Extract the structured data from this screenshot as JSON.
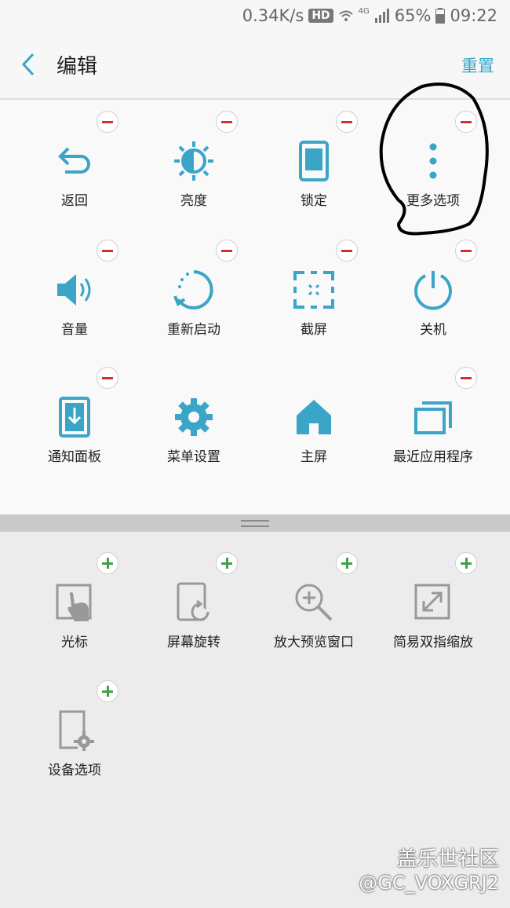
{
  "status_bar": {
    "speed": "0.34K/s",
    "hd": "HD",
    "network": "4G",
    "battery": "65%",
    "time": "09:22"
  },
  "header": {
    "title": "编辑",
    "reset_label": "重置"
  },
  "active_items": [
    {
      "label": "返回",
      "icon": "back-arrow-icon"
    },
    {
      "label": "亮度",
      "icon": "brightness-icon"
    },
    {
      "label": "锁定",
      "icon": "lock-screen-icon"
    },
    {
      "label": "更多选项",
      "icon": "more-options-icon"
    },
    {
      "label": "音量",
      "icon": "volume-icon"
    },
    {
      "label": "重新启动",
      "icon": "restart-icon"
    },
    {
      "label": "截屏",
      "icon": "screenshot-icon"
    },
    {
      "label": "关机",
      "icon": "power-icon"
    },
    {
      "label": "通知面板",
      "icon": "notification-panel-icon"
    },
    {
      "label": "菜单设置",
      "icon": "gear-icon"
    },
    {
      "label": "主屏",
      "icon": "home-icon"
    },
    {
      "label": "最近应用程序",
      "icon": "recent-apps-icon"
    }
  ],
  "available_items": [
    {
      "label": "光标",
      "icon": "cursor-icon"
    },
    {
      "label": "屏幕旋转",
      "icon": "screen-rotate-icon"
    },
    {
      "label": "放大预览窗口",
      "icon": "zoom-icon"
    },
    {
      "label": "简易双指缩放",
      "icon": "pinch-zoom-icon"
    },
    {
      "label": "设备选项",
      "icon": "device-options-icon"
    }
  ],
  "watermark": {
    "line1": "盖乐世社区",
    "line2": "@GC_VOXGRJ2"
  },
  "colors": {
    "accent": "#3aa5c7",
    "remove": "#d32f2f",
    "add": "#43a047",
    "inactive_icon": "#999999"
  }
}
